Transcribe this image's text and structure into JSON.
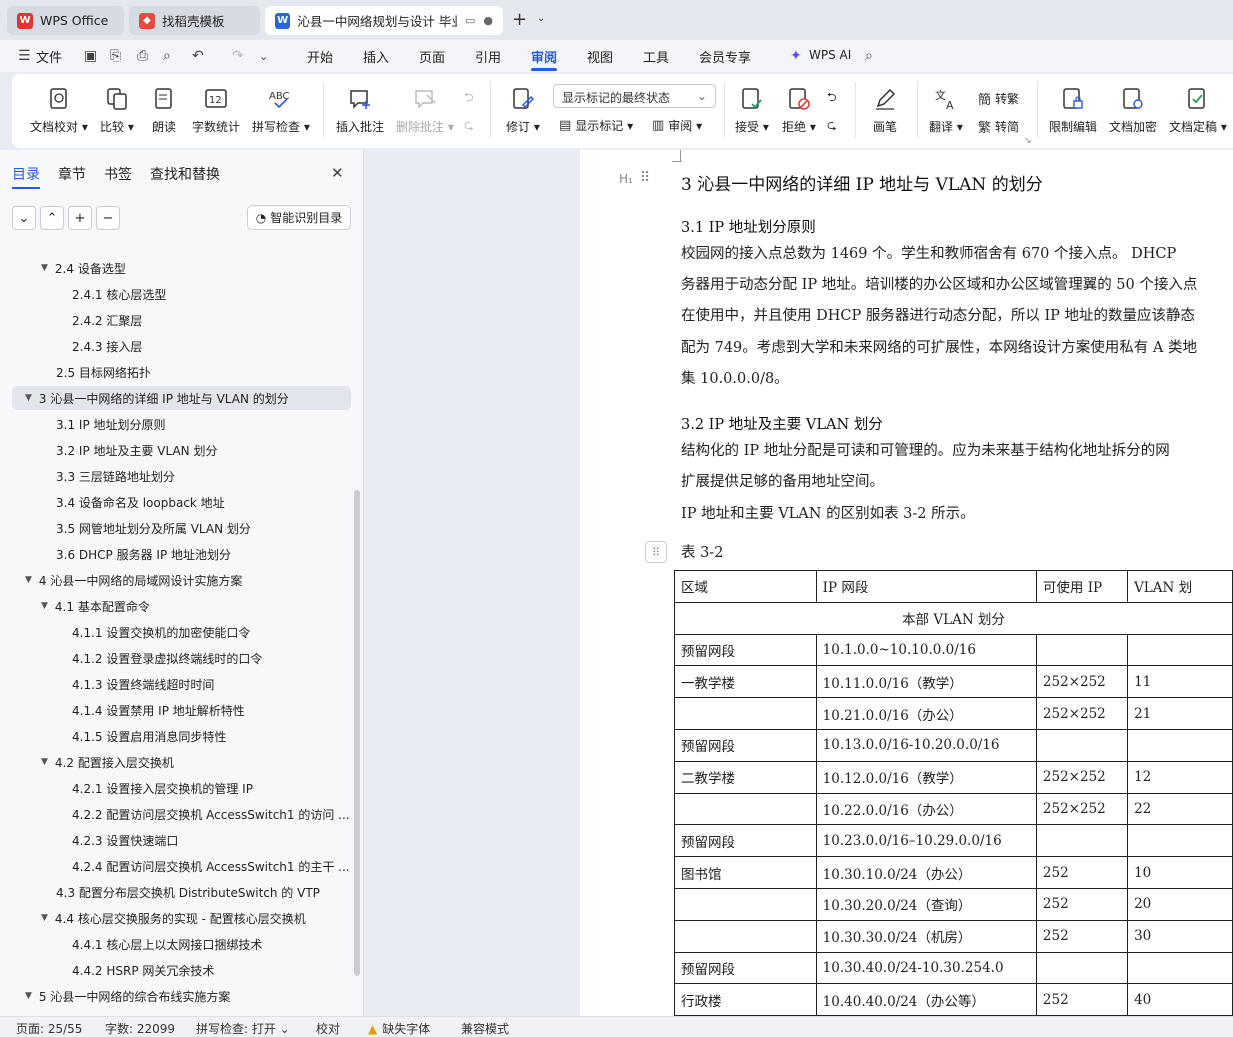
{
  "tabs": [
    {
      "label": "WPS Office",
      "icon": "wps-logo-icon",
      "active": false
    },
    {
      "label": "找稻壳模板",
      "icon": "docer-icon",
      "active": false
    },
    {
      "label": "沁县一中网络规划与设计 毕业",
      "icon": "word-doc-icon",
      "active": true
    }
  ],
  "menubar": {
    "file": "文件",
    "items": [
      "开始",
      "插入",
      "页面",
      "引用",
      "审阅",
      "视图",
      "工具",
      "会员专享"
    ],
    "active": "审阅",
    "wps_ai": "WPS AI"
  },
  "ribbon": {
    "doc_check": "文档校对",
    "compare": "比较",
    "read_aloud": "朗读",
    "word_count": "字数统计",
    "spell_check": "拼写检查",
    "insert_comment": "插入批注",
    "delete_comment": "删除批注",
    "revise": "修订",
    "markup_mode": "显示标记的最终状态",
    "show_markup": "显示标记",
    "review": "审阅",
    "accept": "接受",
    "reject": "拒绝",
    "ink": "画笔",
    "translate": "翻译",
    "to_traditional": "转繁",
    "to_simplified": "转简",
    "restrict_edit": "限制编辑",
    "encrypt": "文档加密",
    "finalize": "文档定稿"
  },
  "nav": {
    "tabs": [
      "目录",
      "章节",
      "书签",
      "查找和替换"
    ],
    "active_tab": "目录",
    "smart_toc": "智能识别目录",
    "toc": [
      {
        "label": "2.4 设备选型",
        "level": 2,
        "caret": true
      },
      {
        "label": "2.4.1 核心层选型",
        "level": 3
      },
      {
        "label": "2.4.2 汇聚层",
        "level": 3
      },
      {
        "label": "2.4.3 接入层",
        "level": 3
      },
      {
        "label": "2.5 目标网络拓扑",
        "level": 2
      },
      {
        "label": "3  沁县一中网络的详细 IP 地址与 VLAN 的划分",
        "level": 1,
        "caret": true,
        "selected": true
      },
      {
        "label": "3.1 IP 地址划分原则",
        "level": 2
      },
      {
        "label": "3.2 IP 地址及主要 VLAN 划分",
        "level": 2
      },
      {
        "label": "3.3 三层链路地址划分",
        "level": 2
      },
      {
        "label": "3.4 设备命名及 loopback 地址",
        "level": 2
      },
      {
        "label": "3.5 网管地址划分及所属 VLAN 划分",
        "level": 2
      },
      {
        "label": "3.6 DHCP 服务器 IP 地址池划分",
        "level": 2
      },
      {
        "label": "4  沁县一中网络的局域网设计实施方案",
        "level": 1,
        "caret": true
      },
      {
        "label": "4.1 基本配置命令",
        "level": 2,
        "caret": true
      },
      {
        "label": "4.1.1 设置交换机的加密使能口令",
        "level": 3
      },
      {
        "label": "4.1.2 设置登录虚拟终端线时的口令",
        "level": 3
      },
      {
        "label": "4.1.3 设置终端线超时时间",
        "level": 3
      },
      {
        "label": "4.1.4 设置禁用 IP 地址解析特性",
        "level": 3
      },
      {
        "label": "4.1.5 设置启用消息同步特性",
        "level": 3
      },
      {
        "label": "4.2 配置接入层交换机",
        "level": 2,
        "caret": true
      },
      {
        "label": "4.2.1 设置接入层交换机的管理 IP",
        "level": 3
      },
      {
        "label": "4.2.2 配置访问层交换机 AccessSwitch1 的访问 ...",
        "level": 3
      },
      {
        "label": "4.2.3 设置快速端口",
        "level": 3
      },
      {
        "label": "4.2.4 配置访问层交换机 AccessSwitch1 的主干 ...",
        "level": 3
      },
      {
        "label": "4.3  配置分布层交换机 DistributeSwitch 的 VTP",
        "level": 2
      },
      {
        "label": "4.4  核心层交换服务的实现 - 配置核心层交换机",
        "level": 2,
        "caret": true
      },
      {
        "label": "4.4.1 核心层上以太网接口捆绑技术",
        "level": 3
      },
      {
        "label": "4.4.2 HSRP 网关冗余技术",
        "level": 3
      },
      {
        "label": "5  沁县一中网络的综合布线实施方案",
        "level": 1,
        "caret": true
      }
    ]
  },
  "doc": {
    "h1": "3  沁县一中网络的详细 IP 地址与 VLAN 的划分",
    "h2_1": "3.1 IP 地址划分原则",
    "p1": [
      "      校园网的接入点总数为 1469 个。学生和教师宿舍有 670  个接入点。 DHCP",
      "务器用于动态分配 IP 地址。培训楼的办公区域和办公区域管理翼的 50 个接入点",
      "在使用中，并且使用 DHCP 服务器进行动态分配，所以 IP 地址的数量应该静态",
      "配为 749。考虑到大学和未来网络的可扩展性，本网络设计方案使用私有 A 类地",
      "集 10.0.0.0/8。"
    ],
    "h2_2": "3.2 IP 地址及主要 VLAN 划分",
    "p2": [
      "      结构化的 IP 地址分配是可读和可管理的。应为未来基于结构化地址拆分的网",
      "扩展提供足够的备用地址空间。",
      "      IP 地址和主要 VLAN 的区别如表 3-2 所示。"
    ],
    "table_caption": "表 3-2",
    "table": {
      "headers": [
        "区域",
        "IP 网段",
        "可使用 IP",
        "VLAN 划"
      ],
      "merged_row": "本部 VLAN 划分",
      "rows": [
        [
          "预留网段",
          "10.1.0.0~10.10.0.0/16",
          "",
          ""
        ],
        [
          "一教学楼",
          "10.11.0.0/16（教学）",
          "252×252",
          "11"
        ],
        [
          "",
          "10.21.0.0/16（办公）",
          "252×252",
          "21"
        ],
        [
          "预留网段",
          "10.13.0.0/16-10.20.0.0/16",
          "",
          ""
        ],
        [
          "二教学楼",
          "10.12.0.0/16（教学）",
          "252×252",
          "12"
        ],
        [
          "",
          "10.22.0.0/16（办公）",
          "252×252",
          "22"
        ],
        [
          "预留网段",
          "10.23.0.0/16–10.29.0.0/16",
          "",
          ""
        ],
        [
          "图书馆",
          "10.30.10.0/24（办公）",
          "252",
          "10"
        ],
        [
          "",
          "10.30.20.0/24（查询）",
          "252",
          "20"
        ],
        [
          "",
          "10.30.30.0/24（机房）",
          "252",
          "30"
        ],
        [
          "预留网段",
          "10.30.40.0/24-10.30.254.0",
          "",
          ""
        ],
        [
          "行政楼",
          "10.40.40.0/24（办公等）",
          "252",
          "40"
        ]
      ]
    }
  },
  "status": {
    "page": "页面: 25/55",
    "words": "字数: 22099",
    "spell": "拼写检查: 打开",
    "proof": "校对",
    "missing_font": "缺失字体",
    "compat": "兼容模式"
  },
  "colors": {
    "accent": "#2a5bd7",
    "wps_red": "#e5322d",
    "docer_red": "#e34b3f",
    "word_blue": "#2b66d9"
  }
}
